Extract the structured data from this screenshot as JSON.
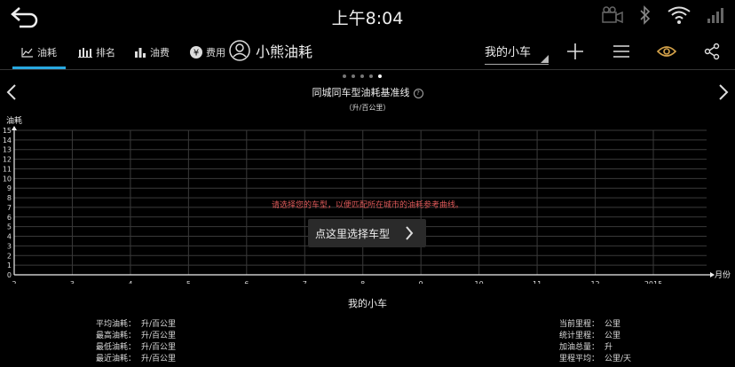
{
  "status": {
    "time": "上午8:04"
  },
  "tabs": [
    {
      "label": "油耗",
      "icon": "line-chart-icon"
    },
    {
      "label": "排名",
      "icon": "ranking-icon"
    },
    {
      "label": "油费",
      "icon": "bar-chart-icon"
    },
    {
      "label": "费用",
      "icon": "yen-icon"
    }
  ],
  "brand": {
    "name": "小熊油耗"
  },
  "car_select": {
    "value": "我的小车"
  },
  "chart_data": {
    "type": "line",
    "title": "同城同车型油耗基准线",
    "subtitle": "（升/百公里）",
    "ylabel": "油耗",
    "xlabel": "月份",
    "yticks": [
      0,
      1,
      2,
      3,
      4,
      5,
      6,
      7,
      8,
      9,
      10,
      11,
      12,
      13,
      14,
      15
    ],
    "xticks": [
      "2",
      "3",
      "4",
      "5",
      "6",
      "7",
      "8",
      "9",
      "10",
      "11",
      "12",
      "2015"
    ],
    "ylim": [
      0,
      15
    ],
    "grid": true,
    "series": []
  },
  "hint": "请选择您的车型，以便匹配所在城市的油耗参考曲线。",
  "pick_button": "点这里选择车型",
  "car_name": "我的小车",
  "left_stats": [
    {
      "label": "平均油耗：",
      "value": "升/百公里"
    },
    {
      "label": "最高油耗：",
      "value": "升/百公里"
    },
    {
      "label": "最低油耗：",
      "value": "升/百公里"
    },
    {
      "label": "最近油耗：",
      "value": "升/百公里"
    }
  ],
  "right_stats": [
    {
      "label": "当前里程：",
      "value": "公里"
    },
    {
      "label": "统计里程：",
      "value": "公里"
    },
    {
      "label": "加油总量：",
      "value": "升"
    },
    {
      "label": "里程平均：",
      "value": "公里/天"
    }
  ],
  "colors": {
    "accent": "#29a8e0",
    "hint": "#e05a5a",
    "eye": "#d4a24a"
  }
}
